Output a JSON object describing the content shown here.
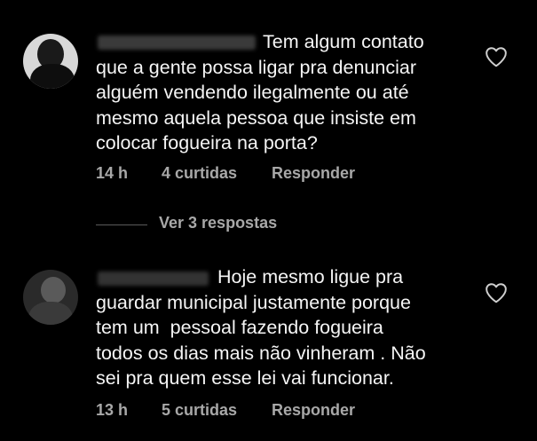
{
  "comments": [
    {
      "text": "Tem algum contato\nque a gente possa ligar pra denunciar\nalguém vendendo ilegalmente ou até\nmesmo aquela pessoa que insiste em\ncolocar fogueira na porta?",
      "time": "14 h",
      "likes": "4 curtidas",
      "reply": "Responder"
    },
    {
      "text": "Hoje mesmo ligue pra\nguardar municipal justamente porque\ntem um  pessoal fazendo fogueira\ntodos os dias mais não vinheram . Não\nsei pra quem esse lei vai funcionar.",
      "time": "13 h",
      "likes": "5 curtidas",
      "reply": "Responder"
    }
  ],
  "view_replies": "Ver 3 respostas",
  "icons": {
    "like": "heart-outline-icon",
    "avatar": "avatar"
  },
  "colors": {
    "background": "#000000",
    "text": "#f5f5f5",
    "meta": "#a8a8a8"
  }
}
